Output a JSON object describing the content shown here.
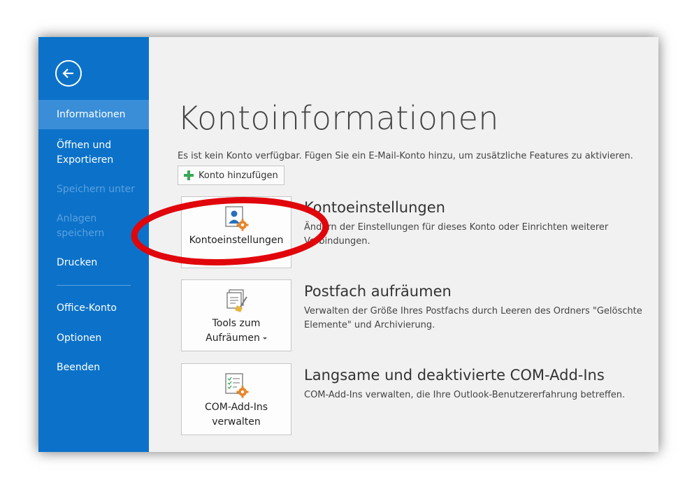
{
  "sidebar": {
    "items": [
      {
        "label": "Informationen"
      },
      {
        "label": "Öffnen und Exportieren"
      },
      {
        "label": "Speichern unter"
      },
      {
        "label": "Anlagen speichern"
      },
      {
        "label": "Drucken"
      },
      {
        "label": "Office-Konto"
      },
      {
        "label": "Optionen"
      },
      {
        "label": "Beenden"
      }
    ],
    "back_icon": "back-arrow-icon"
  },
  "main": {
    "title": "Kontoinformationen",
    "info_text": "Es ist kein Konto verfügbar. Fügen Sie ein E-Mail-Konto hinzu, um zusätzliche Features zu aktivieren.",
    "add_account_label": "Konto hinzufügen",
    "sections": [
      {
        "tile_label": "Kontoeinstellungen",
        "title": "Kontoeinstellungen",
        "description": "Ändern der Einstellungen für dieses Konto oder Einrichten weiterer Verbindungen."
      },
      {
        "tile_label_line1": "Tools zum",
        "tile_label_line2": "Aufräumen",
        "title": "Postfach aufräumen",
        "description": "Verwalten der Größe Ihres Postfachs durch Leeren des Ordners \"Gelöschte Elemente\" und Archivierung."
      },
      {
        "tile_label_line1": "COM-Add-Ins",
        "tile_label_line2": "verwalten",
        "title": "Langsame und deaktivierte COM-Add-Ins",
        "description": "COM-Add-Ins verwalten, die Ihre Outlook-Benutzererfahrung betreffen."
      }
    ]
  },
  "colors": {
    "sidebar": "#0c72c9",
    "sidebar_active": "#3a8ed8",
    "accent_green": "#3aa757",
    "accent_orange": "#e8862a",
    "annotation_red": "#e0060b"
  }
}
